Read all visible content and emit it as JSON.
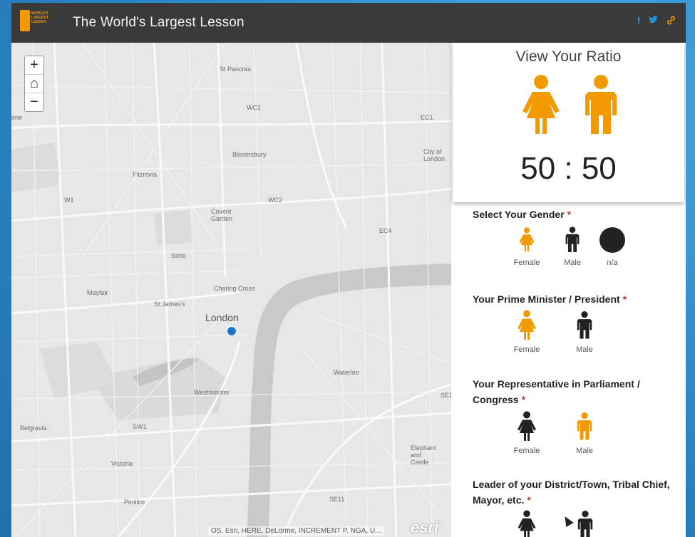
{
  "header": {
    "logo_text": "WORLD'S LARGEST LESSON",
    "title": "The World's Largest Lesson",
    "social": [
      "f",
      "t",
      "link"
    ]
  },
  "map": {
    "zoom_in": "+",
    "home": "⌂",
    "zoom_out": "−",
    "labels": {
      "st_pancras": "St Pancras",
      "wc1": "WC1",
      "ec1": "EC1",
      "city_of_london": "City of London",
      "bloomsbury": "Bloomsbury",
      "fitzrovia": "Fitzrovia",
      "w1": "W1",
      "wc2": "WC2",
      "covent_garden": "Covent Garden",
      "ec4": "EC4",
      "soho": "Soho",
      "mayfair": "Mayfair",
      "st_james": "St James's",
      "charing_cross": "Charing Cross",
      "london": "London",
      "waterloo": "Waterloo",
      "westminster": "Westminster",
      "se1": "SE1",
      "belgravia": "Belgravia",
      "sw1": "SW1",
      "victoria": "Victoria",
      "elephant": "Elephant and Castle",
      "pimlico": "Pimlico",
      "se11": "SE11",
      "one": "one"
    },
    "attribution": "OS, Esri, HERE, DeLorme, INCREMENT P, NGA, U...",
    "esri_logo": "esri"
  },
  "panel": {
    "ratio_title": "View Your Ratio",
    "ratio_value": "50 : 50",
    "questions": [
      {
        "label": "Select Your Gender",
        "star": "*",
        "options": [
          "Female",
          "Male",
          "n/a"
        ]
      },
      {
        "label": "Your Prime Minister / President",
        "star": "*",
        "options": [
          "Female",
          "Male"
        ]
      },
      {
        "label": "Your Representative in Parliament / Congress",
        "star": "*",
        "options": [
          "Female",
          "Male"
        ]
      },
      {
        "label": "Leader of your District/Town, Tribal Chief, Mayor, etc.",
        "star": "*",
        "options": []
      }
    ]
  },
  "colors": {
    "accent": "#f39a00",
    "dark": "#222222",
    "header_bg": "#3a3a3a",
    "required": "#c0392b"
  }
}
